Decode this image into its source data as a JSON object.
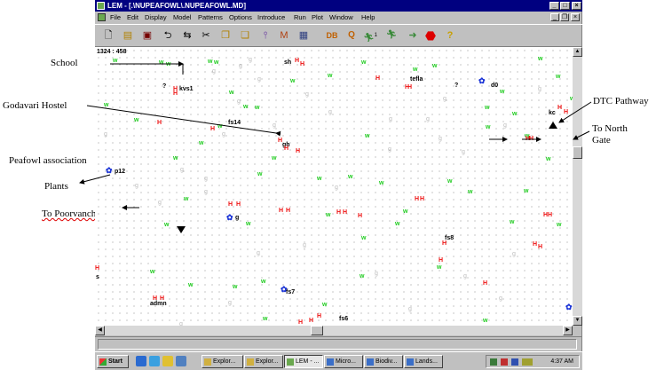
{
  "annotations": {
    "school": "School",
    "godavari": "Godavari Hostel",
    "peafowl": "Peafowl association",
    "plants": "Plants",
    "poorvanchal": "To Poorvanchal",
    "dtc": "DTC Pathway",
    "north_1": "To North",
    "north_2": "Gate"
  },
  "window": {
    "title": "LEM - [.\\NUPEAFOWL\\.NUPEAFOWL.MD]",
    "buttons": {
      "minimize": "_",
      "maximize": "□",
      "close": "×"
    },
    "mdi_buttons": {
      "minimize": "_",
      "restore": "❐",
      "close": "×"
    }
  },
  "menu": [
    "File",
    "Edit",
    "Display",
    "Model",
    "Patterns",
    "Options",
    "Introduce",
    "Run",
    "Plot",
    "Window",
    "Help"
  ],
  "toolbar": {
    "db": "DB",
    "q": "Q",
    "one": "1",
    "ten": "10"
  },
  "canvas": {
    "coords": "1324 : 458",
    "labels": {
      "kvs1": "kvs1",
      "sh": "sh",
      "tefla": "tefla",
      "q1": "?",
      "q2": "?",
      "d0": "d0",
      "fs14": "fs14",
      "gh": "gh",
      "kc": "kc",
      "p12": "p12",
      "g": "g",
      "fs8": "fs8",
      "s": "s",
      "admn": "admn",
      "fs7": "fs7",
      "fs6": "fs6"
    },
    "marker_w": "w",
    "marker_h": "H",
    "marker_sheep": "g",
    "cluster_glyph": "✿"
  },
  "taskbar": {
    "start": "Start",
    "tasks": [
      "Explor...",
      "Explor...",
      "LEM - ...",
      "Micro...",
      "Biodiv...",
      "Lands..."
    ],
    "clock": "4:37 AM"
  },
  "colors": {
    "title_bg": "#000080",
    "chrome": "#c0c0c0",
    "wolf": "#22cc22",
    "hare": "#ee1111",
    "cluster": "#1a33d6"
  }
}
